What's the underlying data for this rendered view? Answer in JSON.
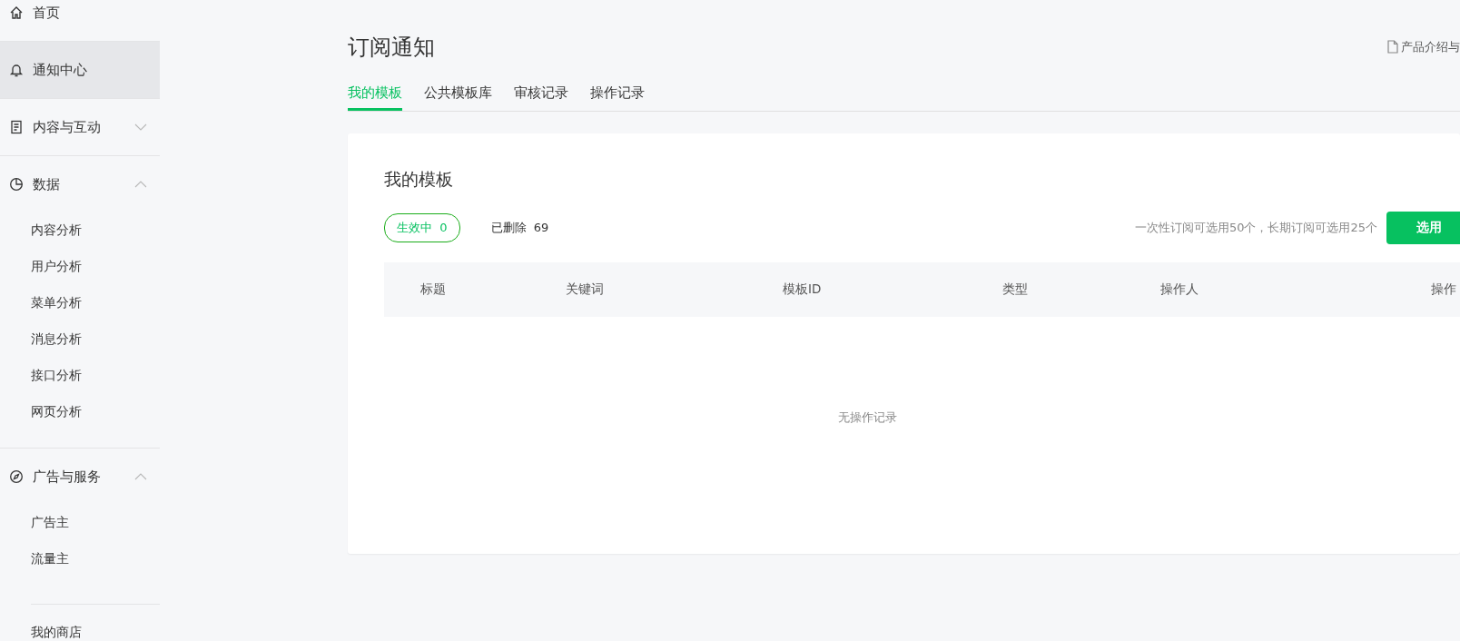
{
  "sidebar": {
    "sections": [
      {
        "kind": "nav",
        "label": "首页",
        "selected": false
      },
      {
        "kind": "nav",
        "label": "通知中心",
        "selected": true
      },
      {
        "kind": "nav",
        "label": "内容与互动",
        "selected": false,
        "expanded": false
      },
      {
        "kind": "nav",
        "label": "数据",
        "selected": false,
        "expanded": true,
        "children": [
          "内容分析",
          "用户分析",
          "菜单分析",
          "消息分析",
          "接口分析",
          "网页分析"
        ]
      },
      {
        "kind": "nav",
        "label": "广告与服务",
        "selected": false,
        "expanded": true,
        "children": [
          "广告主",
          "流量主"
        ]
      },
      {
        "kind": "sub",
        "label": "我的商店",
        "selected": false
      }
    ]
  },
  "header": {
    "title": "订阅通知",
    "help_link": "产品介绍与"
  },
  "tabs": [
    {
      "label": "我的模板",
      "selected": true
    },
    {
      "label": "公共模板库",
      "selected": false
    },
    {
      "label": "审核记录",
      "selected": false
    },
    {
      "label": "操作记录",
      "selected": false
    }
  ],
  "card": {
    "title": "我的模板",
    "filters": [
      {
        "label": "生效中",
        "count": "0",
        "selected": true
      },
      {
        "label": "已删除",
        "count": "69",
        "selected": false
      }
    ],
    "hint": "一次性订阅可选用50个，长期订阅可选用25个",
    "button": "选用",
    "table": {
      "columns": [
        "标题",
        "关键词",
        "模板ID",
        "类型",
        "操作人",
        "操作"
      ],
      "empty_text": "无操作记录"
    }
  }
}
